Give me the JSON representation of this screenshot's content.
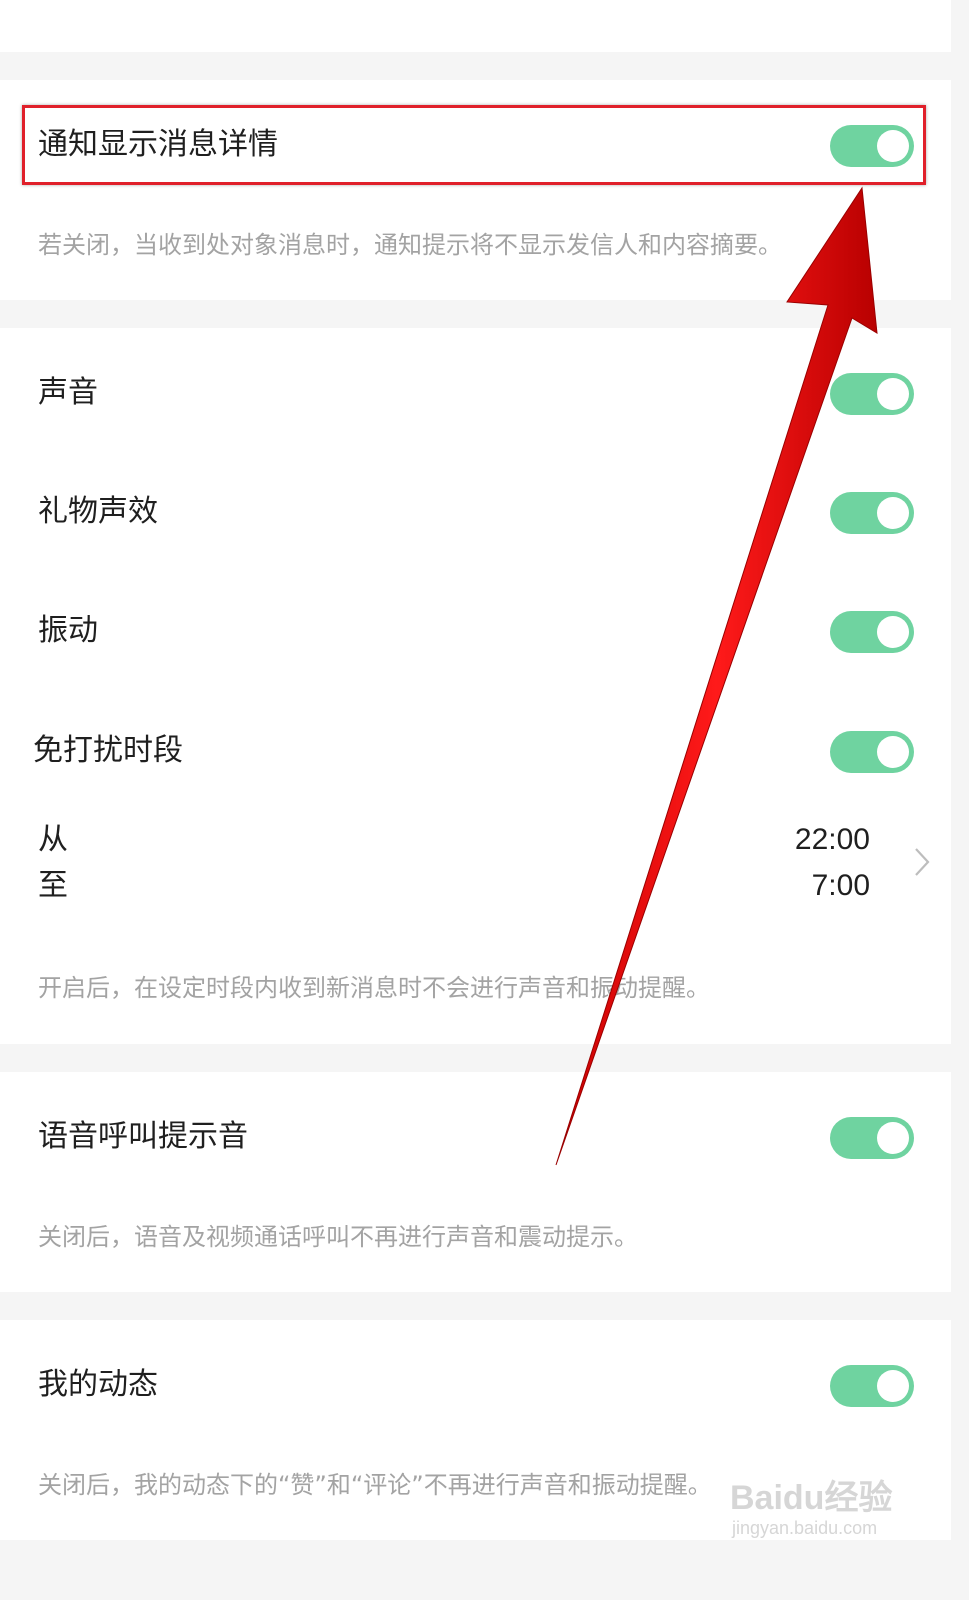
{
  "sections": {
    "notify_detail": {
      "label": "通知显示消息详情",
      "hint": "若关闭，当收到处对象消息时，通知提示将不显示发信人和内容摘要。",
      "enabled": true
    },
    "sound": {
      "label": "声音",
      "enabled": true
    },
    "gift_sound": {
      "label": "礼物声效",
      "enabled": true
    },
    "vibrate": {
      "label": "振动",
      "enabled": true
    },
    "dnd": {
      "label": "免打扰时段",
      "enabled": true,
      "from_label": "从",
      "from_time": "22:00",
      "to_label": "至",
      "to_time": "7:00",
      "hint": "开启后，在设定时段内收到新消息时不会进行声音和振动提醒。"
    },
    "voice_call": {
      "label": "语音呼叫提示音",
      "enabled": true,
      "hint": "关闭后，语音及视频通话呼叫不再进行声音和震动提示。"
    },
    "my_moments": {
      "label": "我的动态",
      "enabled": true,
      "hint": "关闭后，我的动态下的“赞”和“评论”不再进行声音和振动提醒。"
    }
  },
  "watermark": {
    "text": "Baidu经验",
    "url_text": "jingyan.baidu.com"
  },
  "colors": {
    "toggle_on": "#6fd3a0",
    "annotation": "#e0202a",
    "hint_text": "#a3a3a3"
  }
}
